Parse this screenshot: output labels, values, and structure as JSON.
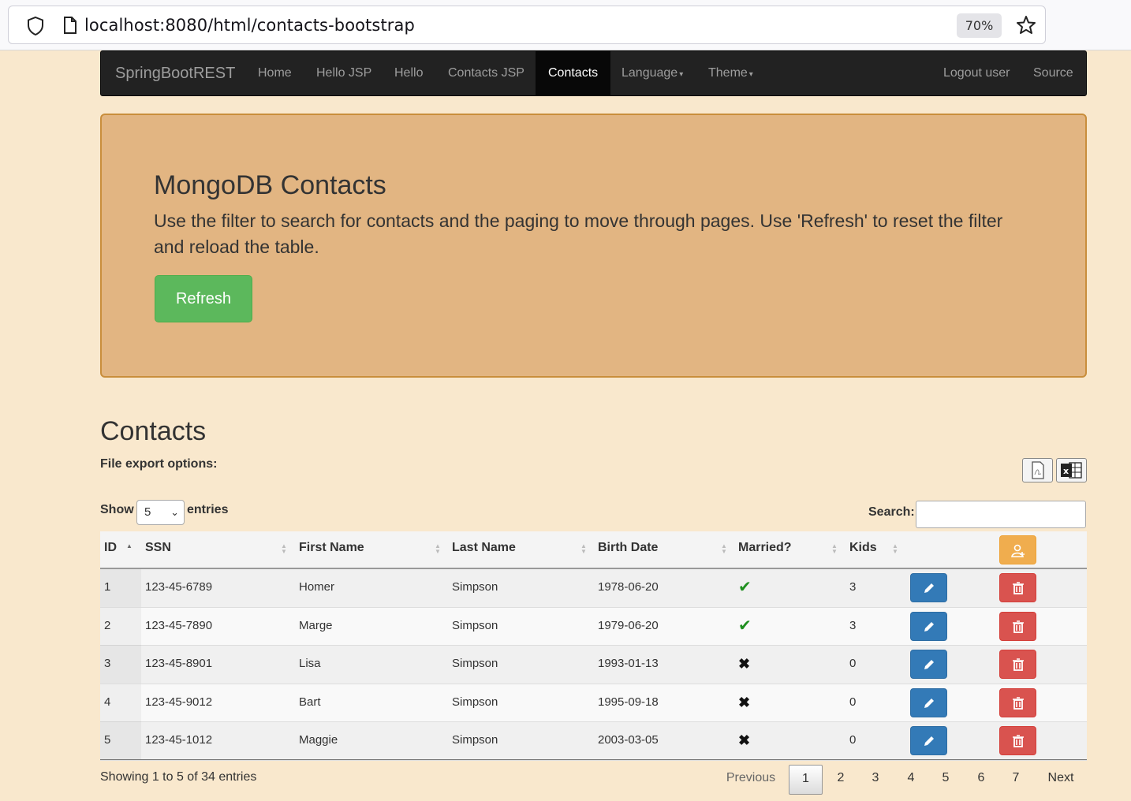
{
  "browser": {
    "url": "localhost:8080/html/contacts-bootstrap",
    "zoom": "70%"
  },
  "navbar": {
    "brand": "SpringBootREST",
    "items": [
      {
        "label": "Home"
      },
      {
        "label": "Hello JSP"
      },
      {
        "label": "Hello"
      },
      {
        "label": "Contacts JSP"
      },
      {
        "label": "Contacts",
        "active": true
      },
      {
        "label": "Language"
      },
      {
        "label": "Theme"
      }
    ],
    "right_items": [
      {
        "label": "Logout user"
      },
      {
        "label": "Source"
      }
    ]
  },
  "jumbotron": {
    "title": "MongoDB Contacts",
    "description": "Use the filter to search for contacts and the paging to move through pages. Use 'Refresh' to reset the filter and reload the table.",
    "refresh_label": "Refresh"
  },
  "contacts": {
    "title": "Contacts",
    "export_label": "File export options:",
    "export_buttons": [
      "pdf-icon",
      "excel-icon"
    ],
    "show_label": "Show",
    "page_size": "5",
    "entries_label": "entries",
    "search_label": "Search:",
    "search_value": "",
    "columns": [
      "ID",
      "SSN",
      "First Name",
      "Last Name",
      "Birth Date",
      "Married?",
      "Kids"
    ],
    "rows": [
      {
        "id": "1",
        "ssn": "123-45-6789",
        "first": "Homer",
        "last": "Simpson",
        "birth": "1978-06-20",
        "married": "✔",
        "kids": "3"
      },
      {
        "id": "2",
        "ssn": "123-45-7890",
        "first": "Marge",
        "last": "Simpson",
        "birth": "1979-06-20",
        "married": "✔",
        "kids": "3"
      },
      {
        "id": "3",
        "ssn": "123-45-8901",
        "first": "Lisa",
        "last": "Simpson",
        "birth": "1993-01-13",
        "married": "✖",
        "kids": "0"
      },
      {
        "id": "4",
        "ssn": "123-45-9012",
        "first": "Bart",
        "last": "Simpson",
        "birth": "1995-09-18",
        "married": "✖",
        "kids": "0"
      },
      {
        "id": "5",
        "ssn": "123-45-1012",
        "first": "Maggie",
        "last": "Simpson",
        "birth": "2003-03-05",
        "married": "✖",
        "kids": "0"
      }
    ],
    "info": "Showing 1 to 5 of 34 entries",
    "pagination": {
      "previous": "Previous",
      "pages": [
        "1",
        "2",
        "3",
        "4",
        "5",
        "6",
        "7"
      ],
      "current": "1",
      "next": "Next"
    }
  },
  "colors": {
    "page_bg": "#f9e8cd",
    "jumbotron_bg": "#e2b582",
    "navbar_bg": "#222222",
    "success": "#5cb85c",
    "primary": "#337ab7",
    "danger": "#d9534f",
    "warning": "#f0ad4e"
  }
}
